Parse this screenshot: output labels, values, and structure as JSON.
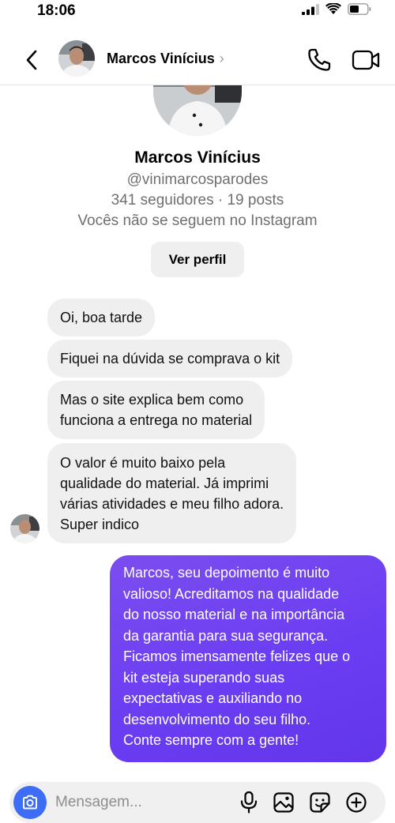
{
  "status_bar": {
    "time": "18:06"
  },
  "header": {
    "name": "Marcos Vinícius",
    "chevron": "›"
  },
  "profile": {
    "name": "Marcos Vinícius",
    "handle": "@vinimarcosparodes",
    "stats": "341 seguidores · 19 posts",
    "follow_status": "Vocês não se seguem no Instagram",
    "view_profile_label": "Ver perfil"
  },
  "messages": [
    {
      "from": "them",
      "text": "Oi, boa tarde"
    },
    {
      "from": "them",
      "text": "Fiquei na dúvida se comprava o kit"
    },
    {
      "from": "them",
      "lines": [
        "Mas o site explica bem como",
        "funciona a entrega no material"
      ]
    },
    {
      "from": "them",
      "lines": [
        "O valor é muito baixo pela",
        "qualidade do material. Já imprimi",
        "várias atividades e meu filho adora.",
        "Super indico"
      ]
    },
    {
      "from": "me",
      "lines": [
        "Marcos, seu depoimento é muito",
        "valioso! Acreditamos na qualidade",
        "do nosso material e na importância",
        "da garantia para sua segurança.",
        "Ficamos imensamente felizes que o",
        "kit esteja superando suas",
        "expectativas e auxiliando no",
        "desenvolvimento do seu filho.",
        "Conte sempre com a gente!"
      ]
    }
  ],
  "composer": {
    "placeholder": "Mensagem..."
  },
  "icons": {
    "back": "chevron-left-icon",
    "call": "phone-icon",
    "video": "video-camera-icon",
    "camera": "camera-icon",
    "mic": "microphone-icon",
    "gallery": "image-icon",
    "sticker": "sticker-icon",
    "add": "plus-circle-icon"
  },
  "colors": {
    "outgoing_bubble": "#6a3cf2",
    "incoming_bubble": "#efefef",
    "camera_button": "#3d6df4"
  }
}
